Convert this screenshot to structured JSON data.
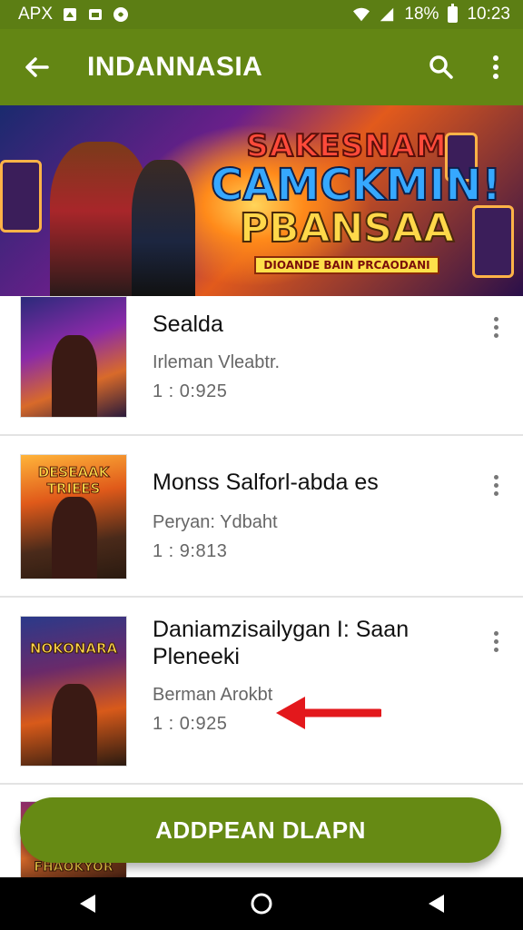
{
  "status_bar": {
    "left_text": "APX",
    "battery_text": "18%",
    "time": "10:23",
    "icons": [
      "notification-icon",
      "photo-icon",
      "media-icon",
      "wifi-icon",
      "signal-icon",
      "battery-icon"
    ]
  },
  "app_bar": {
    "title": "INDANNASIA",
    "icons": [
      "back-arrow-icon",
      "search-icon",
      "more-vert-icon"
    ]
  },
  "banner": {
    "title_line1": "SAKESNAM",
    "title_line2": "CAMCKMIN!",
    "title_line3": "PBANSAA",
    "subtitle": "DIOANDE BAIN PRCAODANI"
  },
  "list": {
    "items": [
      {
        "title": "Sealda",
        "subtitle": "Irleman Vleabtr.",
        "meta": "1 : 0:925",
        "thumb_text": ""
      },
      {
        "title": "Monss Salforl-abda es",
        "subtitle": "Peryan: Ydbaht",
        "meta": "1 : 9:813",
        "thumb_text": "DESEAAK TRIEES"
      },
      {
        "title": "Daniamzisailygan I: Saan Pleneeki",
        "subtitle": "Berman Arokbt",
        "meta": "1 : 0:925",
        "thumb_text": "NOKONARA"
      }
    ],
    "partial_item_thumb_text": "FHAOKYOR"
  },
  "fab": {
    "label": "ADDPEAN DLAPN"
  },
  "colors": {
    "app_bar": "#638614",
    "status_bar": "#5c7e14",
    "fab": "#668a14",
    "annotation_arrow": "#e3181c"
  }
}
